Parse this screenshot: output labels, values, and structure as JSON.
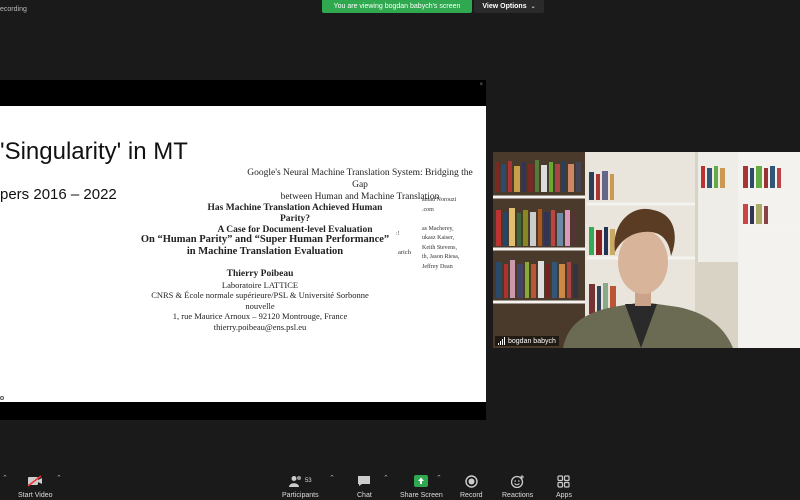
{
  "header": {
    "recording_label": "ecording",
    "viewing_banner": "You are viewing bogdan babych's screen",
    "view_options": "View Options"
  },
  "shared_screen": {
    "close_glyph": "×",
    "slide_title": "'Singularity' in MT",
    "slide_subtitle": "pers 2016 – 2022",
    "paper_google": [
      "Google's Neural Machine Translation System: Bridging the Gap",
      "between Human and Machine Translation"
    ],
    "paper_google_side": [
      "amad Norouzi",
      ".com",
      "",
      "as Macherey,",
      "ukasz Kaiser,",
      "Keith Stevens,",
      "th, Jason Riesa,",
      "Jeffrey Dean"
    ],
    "paper_parity": [
      "Has Machine Translation Achieved Human Parity?",
      "A Case for Document-level Evaluation"
    ],
    "paper_human": [
      "On “Human Parity” and “Super Human Performance”",
      "in Machine Translation Evaluation"
    ],
    "paper_human_side": ":!",
    "paper_human_side2": "arich",
    "author": {
      "name": "Thierry Poibeau",
      "lab": "Laboratoire LATTICE",
      "affil": "CNRS & École normale supérieure/PSL & Université Sorbonne nouvelle",
      "address": "1, rue Maurice Arnoux – 92120 Montrouge, France",
      "email": "thierry.poibeau@ens.psl.eu"
    }
  },
  "video": {
    "participant_name": "bogdan babych"
  },
  "toolbar": {
    "start_video": "Start Video",
    "participants": "Participants",
    "participants_count": "53",
    "chat": "Chat",
    "share_screen": "Share Screen",
    "record": "Record",
    "reactions": "Reactions",
    "apps": "Apps",
    "share_color": "#2fa84f"
  }
}
